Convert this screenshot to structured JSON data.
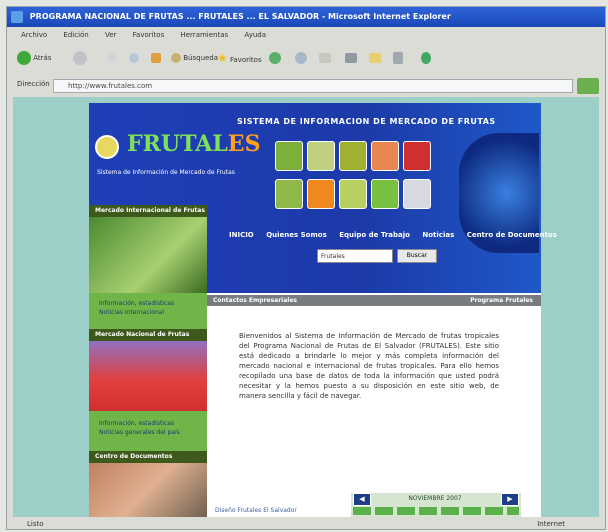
{
  "window": {
    "title": "PROGRAMA NACIONAL DE FRUTAS ... FRUTALES ... EL SALVADOR - Microsoft Internet Explorer"
  },
  "menu": [
    "Archivo",
    "Edición",
    "Ver",
    "Favoritos",
    "Herramientas",
    "Ayuda"
  ],
  "toolbar": {
    "back": "Atrás",
    "search": "Búsqueda",
    "favorites": "Favoritos"
  },
  "address": {
    "label": "Dirección",
    "value": "http://www.frutales.com"
  },
  "site": {
    "banner_title": "SISTEMA DE INFORMACION DE MERCADO DE FRUTAS",
    "logo_main": "FRUTAL",
    "logo_es": "ES",
    "logo_sub": "Sistema de Información de Mercado de Frutas",
    "nav": [
      "INICIO",
      "Quienes Somos",
      "Equipo de Trabajo",
      "Noticias",
      "Centro de Documentos"
    ],
    "search_select": "Frutales",
    "search_button": "Buscar",
    "left": {
      "section1": "Mercado Internacional de Frutas",
      "section1_links": [
        "Información, estadísticas",
        "Noticias Internacional"
      ],
      "section2": "Mercado Nacional de Frutas",
      "section2_links": [
        "Información, estadísticas",
        "Noticias generales del país"
      ],
      "section3": "Centro de Documentos"
    },
    "bar_left": "Contactos Empresariales",
    "bar_right": "Programa Frutales",
    "welcome_text": "Bienvenidos al Sistema de Información de Mercado de frutas tropicales del Programa Nacional de Frutas de El Salvador (FRUTALES). Este sitio está dedicado a brindarle lo mejor y más completa información del mercado nacional e internacional de frutas tropicales. Para ello hemos recopilado una base de datos de toda la información que usted podrá necesitar y la hemos puesto a su disposición en este sitio web, de manera sencilla y fácil de navegar.",
    "calendar_month": "NOVIEMBRE 2007",
    "footer": "Diseño Frutales El Salvador"
  },
  "status": {
    "left": "Listo",
    "right": "Internet"
  },
  "colors": {
    "title_bar": "#2058c8",
    "banner": "#1f3fb8",
    "page_bg": "#9ccfc8",
    "left_col": "#6fb548"
  }
}
